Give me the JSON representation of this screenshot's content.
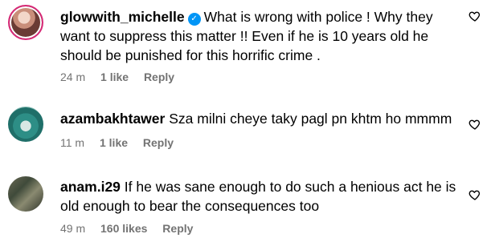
{
  "comments": [
    {
      "username": "glowwith_michelle",
      "verified": true,
      "text": "What is wrong with police ! Why they want to suppress this matter !! Even if he is 10 years old he should be punished for this horrific crime .",
      "time": "24 m",
      "likes": "1 like",
      "reply": "Reply"
    },
    {
      "username": "azambakhtawer",
      "verified": false,
      "text": "Sza milni cheye taky pagl pn khtm ho mmmm",
      "time": "11 m",
      "likes": "1 like",
      "reply": "Reply"
    },
    {
      "username": "anam.i29",
      "verified": false,
      "text": "If he was sane enough to do such a henious act he is old enough to bear the consequences too",
      "time": "49 m",
      "likes": "160 likes",
      "reply": "Reply"
    }
  ],
  "icons": {
    "like": "heart-outline-icon",
    "verified": "verified-badge-icon"
  },
  "colors": {
    "verified": "#0095f6",
    "meta": "#737373",
    "story_ring": "#d62976"
  }
}
